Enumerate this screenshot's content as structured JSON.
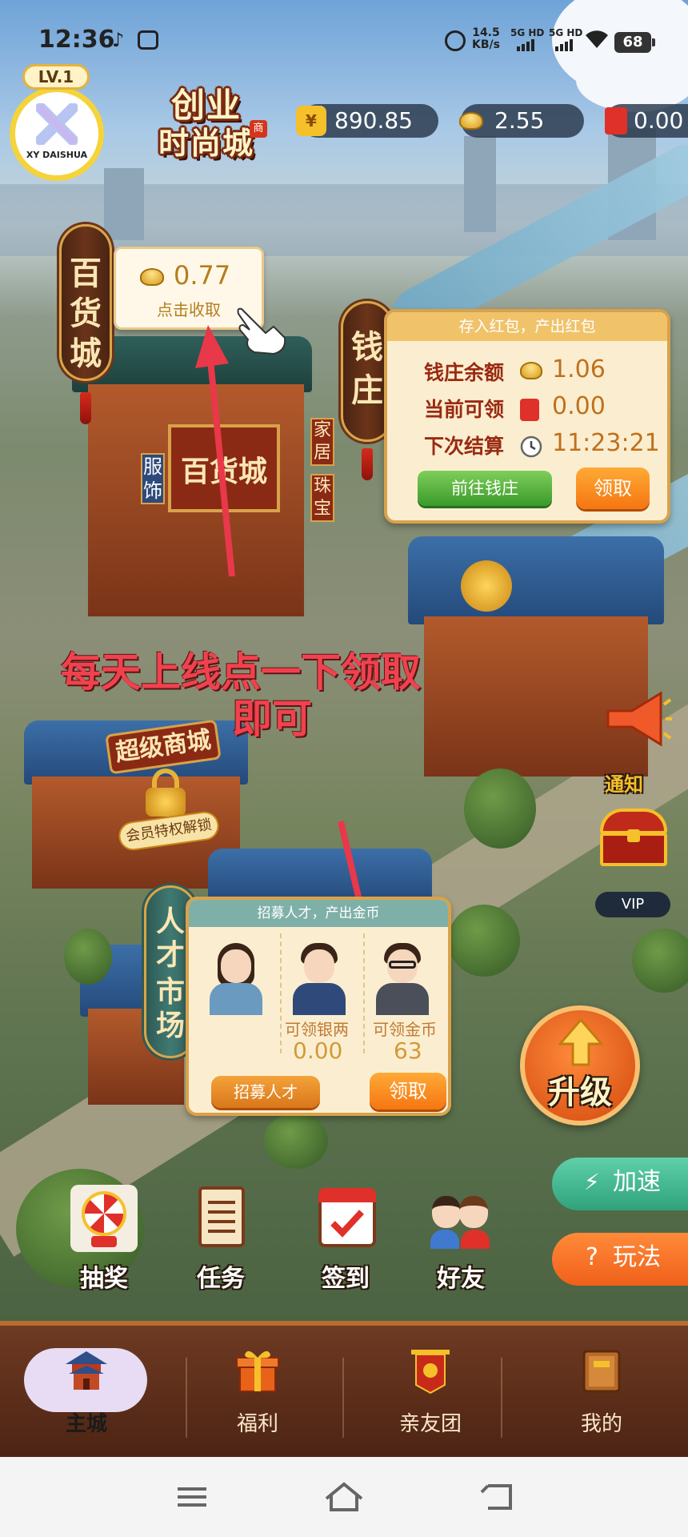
{
  "status_bar": {
    "time": "12:36",
    "net_speed_value": "14.5",
    "net_speed_unit": "KB/s",
    "sim1": "5G HD",
    "sim2": "5G HD",
    "battery": "68",
    "icons": [
      "music-note-icon",
      "app-notification-icon",
      "alarm-icon",
      "wifi-icon",
      "battery-icon"
    ]
  },
  "header": {
    "level": "LV.1",
    "avatar_text": "XY DAISHUA",
    "logo_line1": "创业",
    "logo_line2": "时尚城",
    "currencies": [
      {
        "icon": "yuan-coin-icon",
        "symbol": "¥",
        "value": "890.85"
      },
      {
        "icon": "gold-ingot-icon",
        "value": "2.55"
      },
      {
        "icon": "red-envelope-icon",
        "value": "0.00"
      }
    ]
  },
  "department_store": {
    "sign_line1": "百货",
    "sign_line2": "城",
    "building_label": "百货城",
    "side_sign_left": "服饰",
    "side_sign_right1": "家居",
    "side_sign_right2": "珠宝",
    "bubble_value": "0.77",
    "bubble_action": "点击收取"
  },
  "bank": {
    "sign_line1": "钱",
    "sign_line2": "庄",
    "header": "存入红包，产出红包",
    "rows": [
      {
        "label": "钱庄余额",
        "icon": "gold-ingot-icon",
        "value": "1.06"
      },
      {
        "label": "当前可领",
        "icon": "red-envelope-icon",
        "value": "0.00"
      },
      {
        "label": "下次结算",
        "icon": "clock-icon",
        "value": "11:23:21"
      }
    ],
    "go_button": "前往钱庄",
    "claim_button": "领取"
  },
  "annotation": {
    "line1": "每天上线点一下领取",
    "line2": "即可",
    "color": "#f0424e"
  },
  "super_mall": {
    "label": "超级商城",
    "lock_label": "会员特权解锁"
  },
  "notification": {
    "label": "通知",
    "vip_label": "VIP"
  },
  "talent_market": {
    "sign_line1": "人才",
    "sign_line2": "市场",
    "header": "招募人才，产出金币",
    "silver_label": "可领银两",
    "silver_value": "0.00",
    "gold_label": "可领金币",
    "gold_value": "63",
    "recruit_button": "招募人才",
    "claim_button": "领取"
  },
  "upgrade_button": "升级",
  "side_buttons": {
    "speed": "加速",
    "guide": "玩法",
    "guide_icon_text": "?"
  },
  "features": [
    {
      "label": "抽奖",
      "icon": "lottery-wheel-icon"
    },
    {
      "label": "任务",
      "icon": "scroll-icon"
    },
    {
      "label": "签到",
      "icon": "calendar-check-icon"
    },
    {
      "label": "好友",
      "icon": "friends-icon"
    }
  ],
  "tabs": [
    {
      "label": "主城",
      "icon": "palace-icon",
      "active": true
    },
    {
      "label": "福利",
      "icon": "gift-icon",
      "active": false
    },
    {
      "label": "亲友团",
      "icon": "banner-icon",
      "active": false
    },
    {
      "label": "我的",
      "icon": "book-icon",
      "active": false
    }
  ],
  "colors": {
    "accent_orange": "#f57612",
    "brown_bar": "#4d2414",
    "green_button": "#3a9a2a",
    "panel_bg": "#fbeed0",
    "active_tab_bg": "#e7dcf3"
  }
}
